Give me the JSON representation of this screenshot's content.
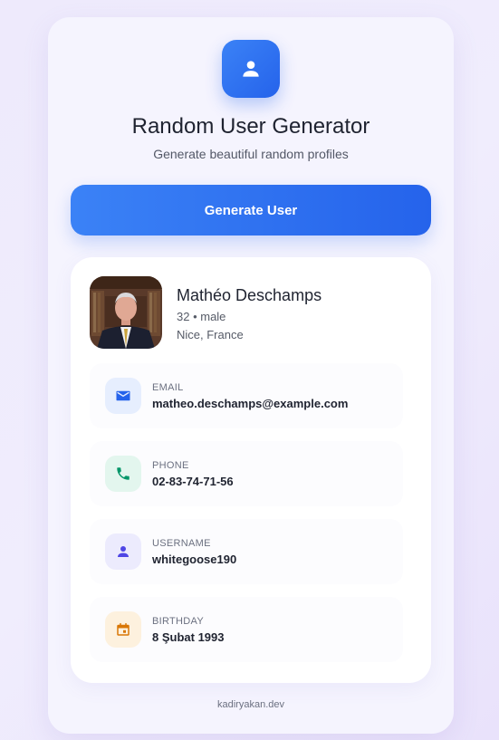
{
  "header": {
    "title": "Random User Generator",
    "subtitle": "Generate beautiful random profiles",
    "logo_icon": "user-icon",
    "accent": "#3b82f6"
  },
  "actions": {
    "generate_label": "Generate User"
  },
  "profile": {
    "name": "Mathéo Deschamps",
    "meta": "32 • male",
    "location": "Nice, France",
    "details": [
      {
        "label": "EMAIL",
        "value": "matheo.deschamps@example.com",
        "icon": "mail-icon",
        "icon_color": "#2563eb",
        "icon_bg": "#e6eefe"
      },
      {
        "label": "PHONE",
        "value": "02-83-74-71-56",
        "icon": "phone-icon",
        "icon_color": "#059669",
        "icon_bg": "#e3f6ee"
      },
      {
        "label": "USERNAME",
        "value": "whitegoose190",
        "icon": "user-icon",
        "icon_color": "#4f46e5",
        "icon_bg": "#ecebfd"
      },
      {
        "label": "BIRTHDAY",
        "value": "8 Şubat 1993",
        "icon": "calendar-icon",
        "icon_color": "#d97706",
        "icon_bg": "#fdf1de"
      }
    ]
  },
  "footer": {
    "text": "kadiryakan.dev"
  }
}
